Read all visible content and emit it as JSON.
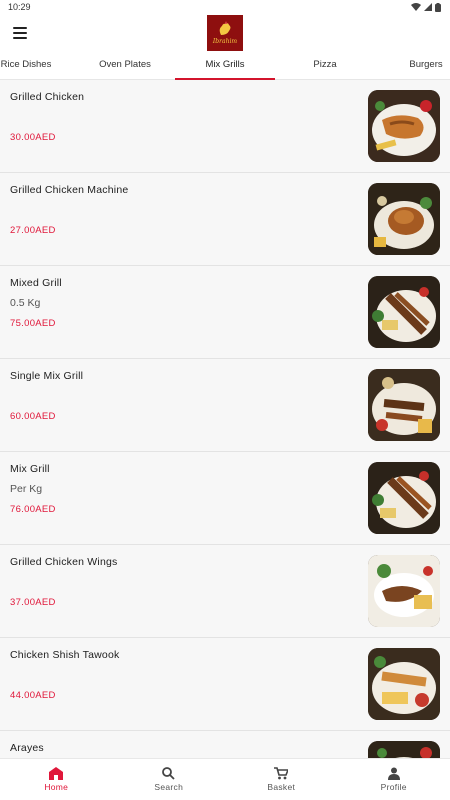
{
  "status": {
    "time": "10:29"
  },
  "header": {
    "logo_text": "Ibrahim"
  },
  "tabs": [
    {
      "label": "Rice Dishes"
    },
    {
      "label": "Oven Plates"
    },
    {
      "label": "Mix Grills"
    },
    {
      "label": "Pizza"
    },
    {
      "label": "Burgers"
    }
  ],
  "active_tab": "Mix Grills",
  "items": [
    {
      "name": "Grilled Chicken",
      "desc": "",
      "price": "30.00AED"
    },
    {
      "name": "Grilled Chicken Machine",
      "desc": "",
      "price": "27.00AED"
    },
    {
      "name": "Mixed Grill",
      "desc": "0.5 Kg",
      "price": "75.00AED"
    },
    {
      "name": "Single Mix Grill",
      "desc": "",
      "price": "60.00AED"
    },
    {
      "name": "Mix Grill",
      "desc": "Per Kg",
      "price": "76.00AED"
    },
    {
      "name": "Grilled Chicken Wings",
      "desc": "",
      "price": "37.00AED"
    },
    {
      "name": "Chicken Shish Tawook",
      "desc": "",
      "price": "44.00AED"
    },
    {
      "name": "Arayes",
      "desc": "",
      "price": ""
    }
  ],
  "bottom_nav": [
    {
      "label": "Home",
      "icon": "home-icon"
    },
    {
      "label": "Search",
      "icon": "search-icon"
    },
    {
      "label": "Basket",
      "icon": "cart-icon"
    },
    {
      "label": "Profile",
      "icon": "profile-icon"
    }
  ],
  "colors": {
    "accent": "#e0173a",
    "logo_bg": "#8e0f0f",
    "list_bg": "#f7f7f7"
  }
}
